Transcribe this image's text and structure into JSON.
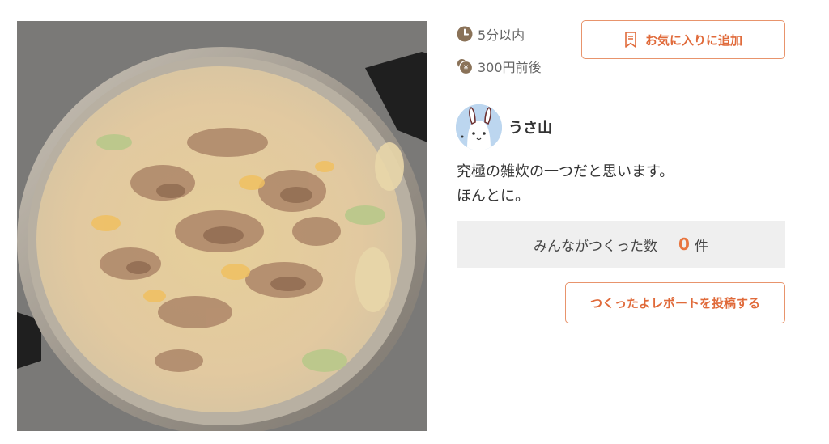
{
  "recipe": {
    "time": "5分以内",
    "cost": "300円前後",
    "favorite_label": "お気に入りに追加",
    "author": {
      "name": "うさ山"
    },
    "description": [
      "究極の雑炊の一つだと思います。",
      "ほんとに。"
    ],
    "made": {
      "label": "みんながつくった数",
      "count": "0",
      "unit": "件"
    },
    "report_label": "つくったよレポートを投稿する"
  },
  "colors": {
    "accent": "#e06a3a",
    "accent_border": "#e8946c",
    "icon_brown": "#8a7258",
    "made_bg": "#efefef"
  },
  "icons": {
    "time": "clock-icon",
    "cost": "coin-icon",
    "favorite": "bookmark-icon"
  }
}
